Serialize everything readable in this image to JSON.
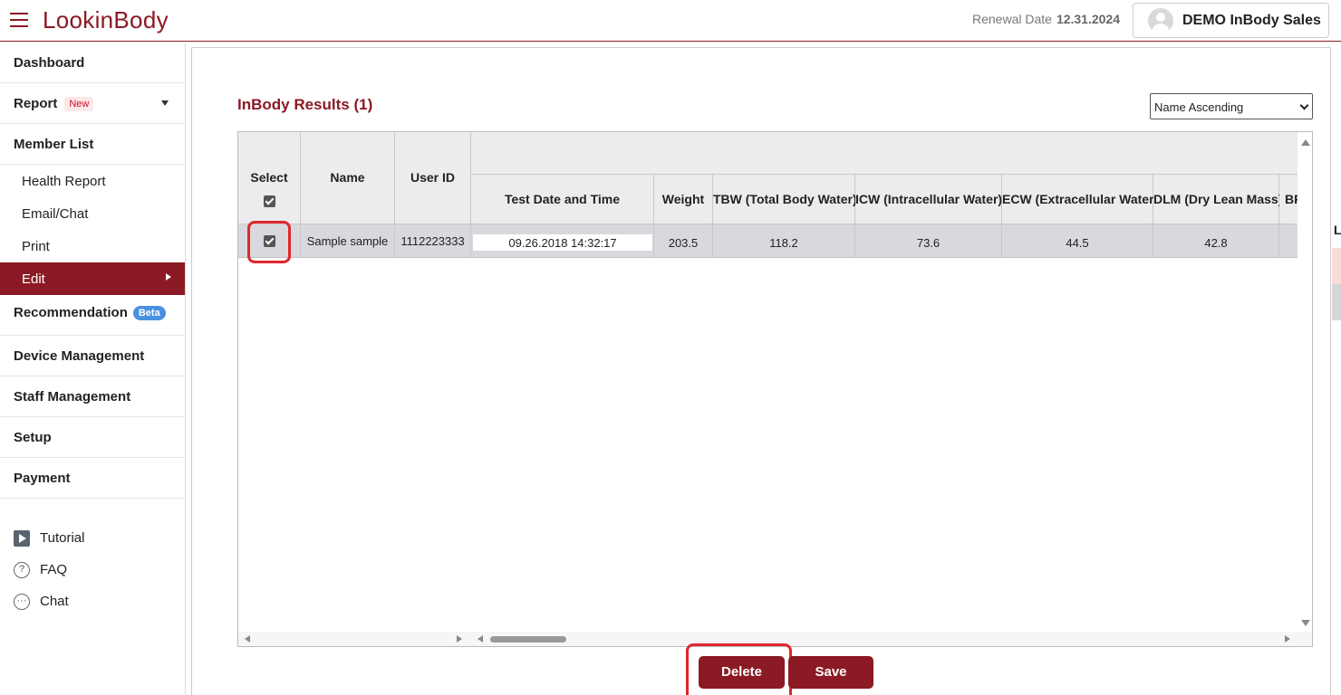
{
  "app": {
    "logo_text": "LookinBody",
    "renewal_label": "Renewal Date",
    "renewal_date": "12.31.2024",
    "user_name": "DEMO InBody Sales"
  },
  "sidebar": {
    "dashboard": "Dashboard",
    "report": "Report",
    "report_badge": "New",
    "member_list": "Member List",
    "sub_items": [
      "Health Report",
      "Email/Chat",
      "Print",
      "Edit"
    ],
    "recommendation": "Recommendation",
    "recommendation_badge": "Beta",
    "device_management": "Device Management",
    "staff_management": "Staff Management",
    "setup": "Setup",
    "payment": "Payment",
    "help": [
      "Tutorial",
      "FAQ",
      "Chat"
    ]
  },
  "main": {
    "title": "InBody Results (1)",
    "sort_selected": "Name Ascending",
    "table": {
      "fixed_headers": {
        "select": "Select",
        "name": "Name",
        "user_id": "User ID"
      },
      "headers": [
        "Test Date and Time",
        "Weight",
        "TBW (Total Body Water)",
        "ICW (Intracellular Water)",
        "ECW (Extracellular Water)",
        "DLM (Dry Lean Mass)",
        "BF"
      ],
      "rows": [
        {
          "selected": true,
          "name": "Sample sample",
          "user_id": "1112223333",
          "test_date": "09.26.2018 14:32:17",
          "weight": "203.5",
          "tbw": "118.2",
          "icw": "73.6",
          "ecw": "44.5",
          "dlm": "42.8"
        }
      ]
    },
    "buttons": {
      "delete": "Delete",
      "save": "Save"
    }
  },
  "edge": {
    "cut_label": "L"
  },
  "colors": {
    "brand": "#8b1a24",
    "highlight": "#e0262c",
    "beta": "#4a90e2"
  }
}
